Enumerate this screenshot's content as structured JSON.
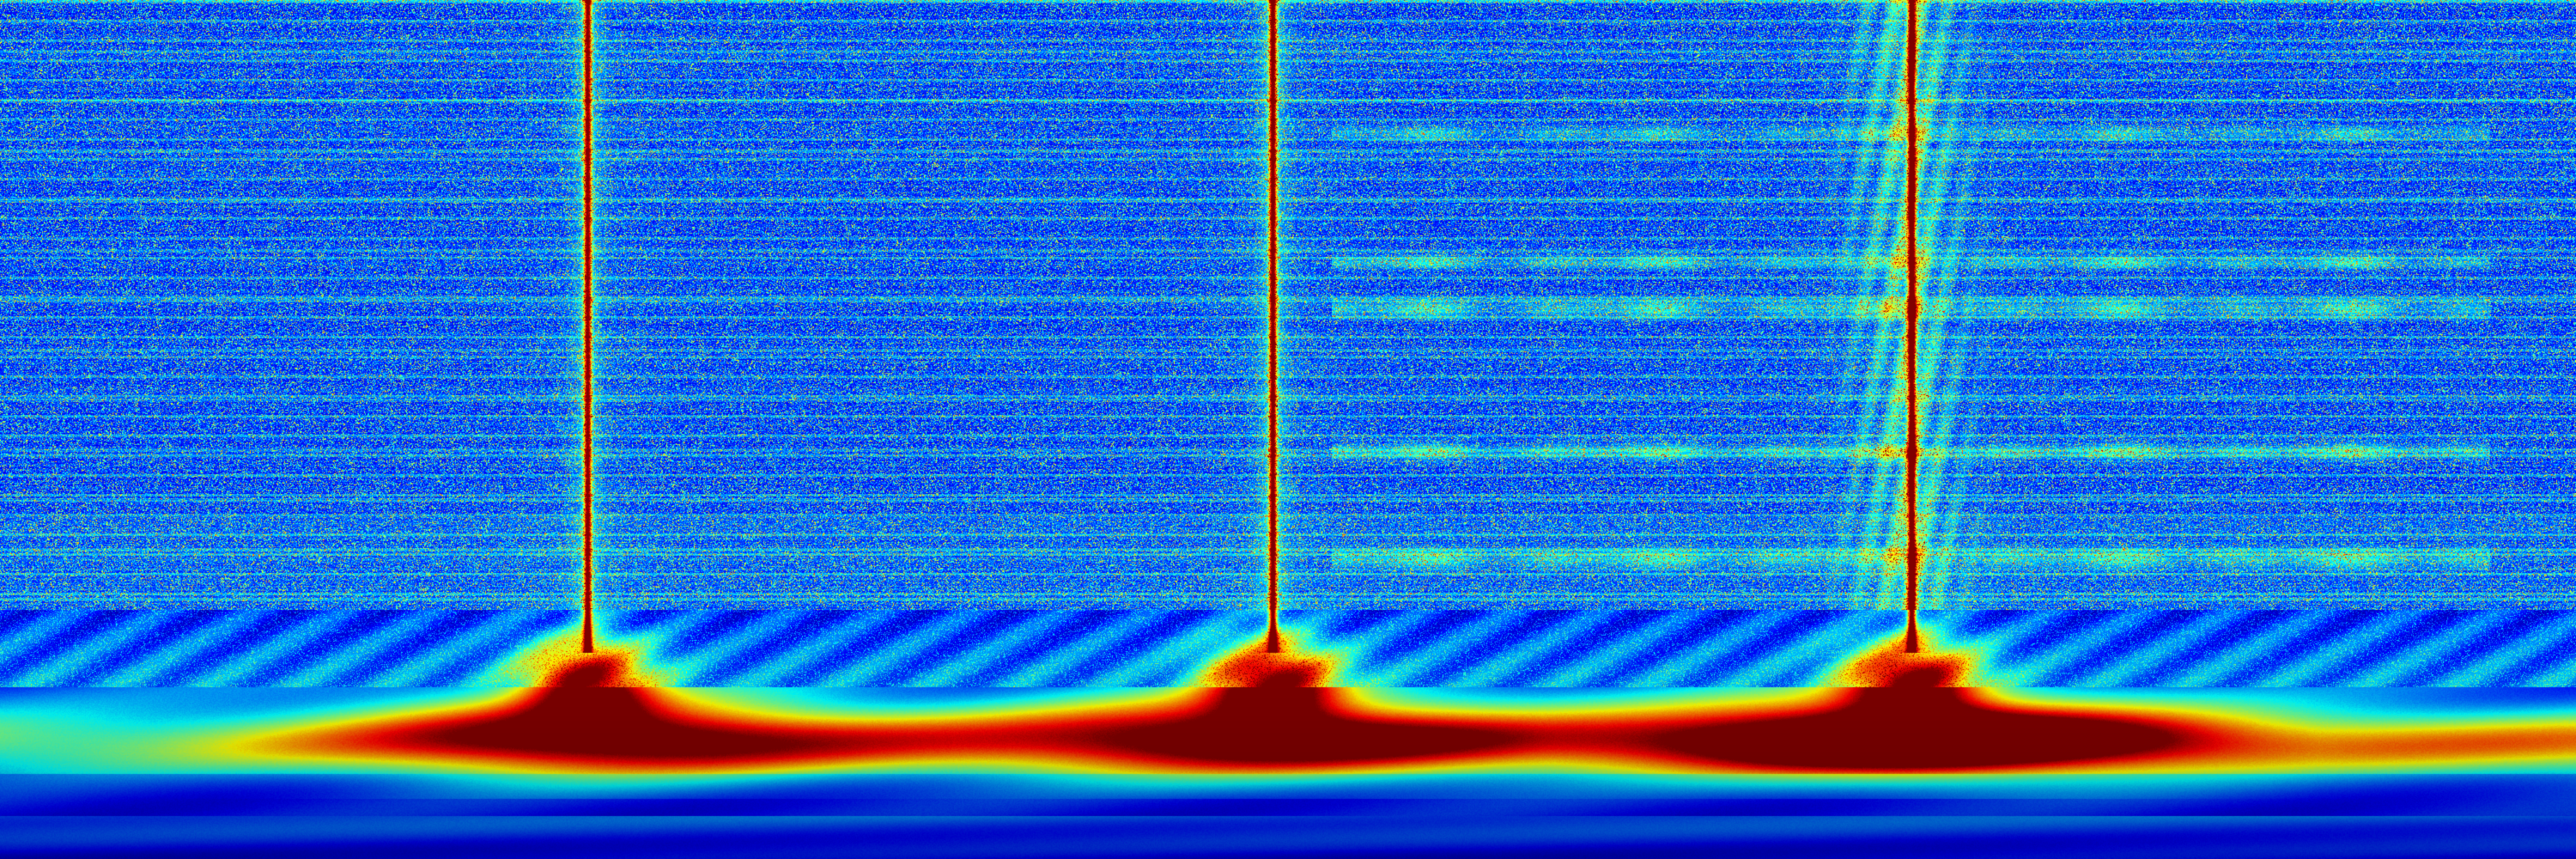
{
  "image": {
    "kind": "spectrogram",
    "colormap": "jet",
    "palette": {
      "background": "#06208f",
      "deep": "#020a5a",
      "low": "#0b34d9",
      "mid_low": "#00b7ff",
      "mid": "#40ff80",
      "mid_high": "#fff000",
      "high": "#ff6a00",
      "peak": "#ff1010"
    },
    "events": [
      {
        "name": "impulse-1",
        "time_fraction": 0.228,
        "strength": 0.9
      },
      {
        "name": "impulse-2",
        "time_fraction": 0.494,
        "strength": 0.95
      },
      {
        "name": "impulse-3",
        "time_fraction": 0.742,
        "strength": 1.0
      }
    ]
  }
}
